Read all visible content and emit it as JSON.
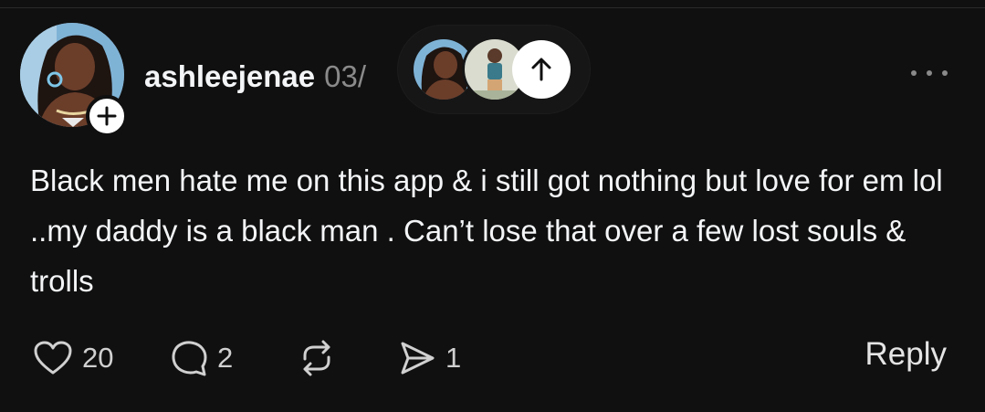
{
  "post": {
    "username": "ashleejenae",
    "timestamp": "03/",
    "text": "Black men hate me on this app & i still got nothing but love for em lol ..my daddy is a black man . Can’t lose that over a few lost souls & trolls"
  },
  "icons": {
    "avatar": "profile-photo",
    "follow": "plus-icon",
    "scroll_up": "arrow-up-icon",
    "more": "more-dots-icon",
    "like": "heart-icon",
    "comment": "comment-bubble-icon",
    "repost": "repost-icon",
    "share": "send-icon"
  },
  "actions": {
    "likes": "20",
    "comments": "2",
    "shares": "1",
    "reply_label": "Reply"
  },
  "colors": {
    "background": "#101010",
    "text": "#f3f5f7",
    "muted": "#8a8a8a"
  }
}
